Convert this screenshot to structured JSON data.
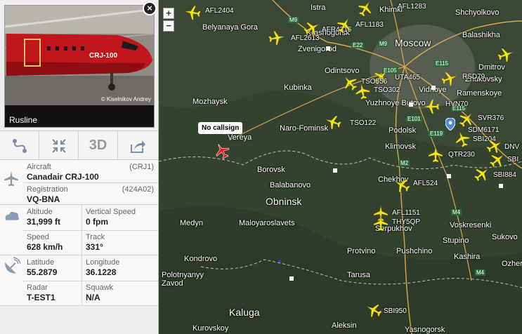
{
  "panel": {
    "photo_credit": "© Kiselnikov Andrey",
    "airline": "Rusline",
    "aircraft_livery_text": "CRJ-100",
    "actions": {
      "route": "route-icon",
      "center": "center-icon",
      "view3d": "3D",
      "share": "share-icon"
    },
    "aircraft": {
      "label": "Aircraft",
      "code": "(CRJ1)",
      "value": "Canadair CRJ-100"
    },
    "registration": {
      "label": "Registration",
      "code": "(424A02)",
      "value": "VQ-BNA"
    },
    "altitude": {
      "label": "Altitude",
      "value": "31,999 ft"
    },
    "vertical_speed": {
      "label": "Vertical Speed",
      "value": "0 fpm"
    },
    "speed": {
      "label": "Speed",
      "value": "628 km/h"
    },
    "track": {
      "label": "Track",
      "value": "331°"
    },
    "latitude": {
      "label": "Latitude",
      "value": "55.2879"
    },
    "longitude": {
      "label": "Longitude",
      "value": "36.1228"
    },
    "radar": {
      "label": "Radar",
      "value": "T-EST1"
    },
    "squawk": {
      "label": "Squawk",
      "value": "N/A"
    }
  },
  "map": {
    "zoom_in": "+",
    "zoom_out": "−",
    "selected_label": "No callsign",
    "cities": [
      "Istra",
      "Khimki",
      "Shchyolkovo",
      "Belyanaya Gora",
      "Krasnogorsk",
      "Balashikha",
      "Zvenigorod",
      "Moscow",
      "Odintsovo",
      "Zhukovsky",
      "Kubinka",
      "Vidnoye",
      "Ramenskoye",
      "Mozhaysk",
      "Yuzhnoye Butovo",
      "Naro-Fominsk",
      "Podolsk",
      "Klimovsk",
      "Vereya",
      "Borovsk",
      "Balabanovo",
      "Chekhov",
      "Obninsk",
      "Medyn",
      "Maloyaroslavets",
      "Serpukhov",
      "Voskresenki",
      "Stupino",
      "Sukovo",
      "Kondrovo",
      "Protvino",
      "Pushchino",
      "Kashira",
      "Polotnyanyy Zavod",
      "Tarusa",
      "Ozher",
      "Kaluga",
      "Kurovskoy",
      "Aleksin",
      "Yasnogorsk",
      "Dmitrov"
    ],
    "callsigns": [
      "AFL2404",
      "AFL2613",
      "AFR4316",
      "AFL1183",
      "UTA465",
      "TSO556",
      "TSO302",
      "RSD79",
      "HVN70",
      "TSO122",
      "SVR376",
      "SDM6171",
      "SBI204",
      "DNV",
      "SBI",
      "QTR230",
      "SBI884",
      "AFL524",
      "AFL1151",
      "THY5QP",
      "SBI950",
      "AFL1283"
    ],
    "roads": [
      "M9",
      "E22",
      "M9",
      "E105",
      "E115",
      "E101",
      "E115",
      "M2",
      "M4",
      "E119",
      "M4"
    ]
  }
}
